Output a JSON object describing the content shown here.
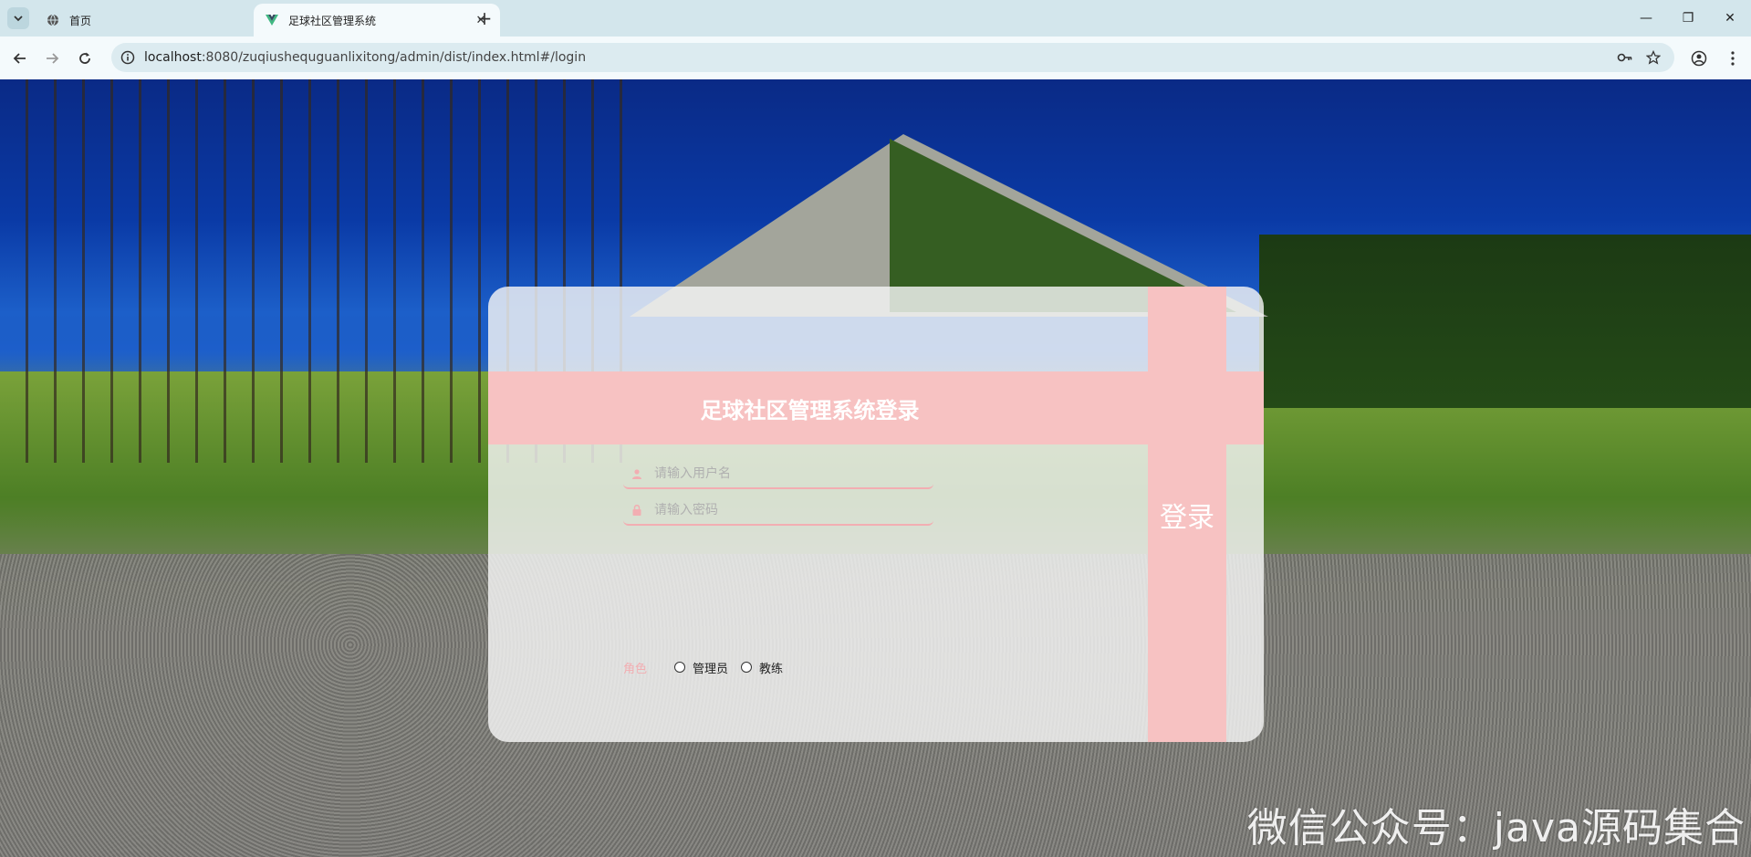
{
  "browser": {
    "tabs": [
      {
        "title": "首页",
        "active": false
      },
      {
        "title": "足球社区管理系统",
        "active": true
      }
    ],
    "url_host": "localhost",
    "url_rest": ":8080/zuqiushequguanlixitong/admin/dist/index.html#/login"
  },
  "login": {
    "title": "足球社区管理系统登录",
    "username_placeholder": "请输入用户名",
    "password_placeholder": "请输入密码",
    "role_label": "角色",
    "roles": [
      "管理员",
      "教练"
    ],
    "submit_label": "登录"
  },
  "colors": {
    "accent_pink": "#f7c2c2",
    "field_underline": "#f2aeb2"
  },
  "watermark": "微信公众号：java源码集合"
}
